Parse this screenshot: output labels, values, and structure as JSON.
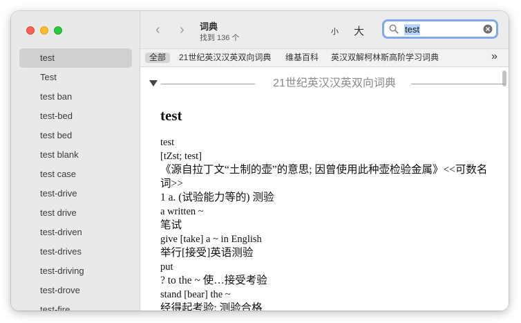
{
  "sidebar": {
    "items": [
      "test",
      "Test",
      "test ban",
      "test-bed",
      "test bed",
      "test blank",
      "test case",
      "test-drive",
      "test drive",
      "test-driven",
      "test-drives",
      "test-driving",
      "test-drove",
      "test-fire"
    ]
  },
  "toolbar": {
    "back": "‹",
    "forward": "›",
    "title": "词典",
    "subtitle": "找到 136 个",
    "font_small": "小",
    "font_large": "大",
    "search_value": "test"
  },
  "tabs": [
    "全部",
    "21世纪英汉汉英双向词典",
    "维基百科",
    "英汉双解柯林斯高阶学习词典"
  ],
  "more_tabs": "»",
  "content": {
    "dictionary_name": "21世纪英汉汉英双向词典",
    "headword": "test",
    "lines": [
      "test",
      "[tZst; test]",
      "《源自拉丁文“土制的壶”的意思; 因曾使用此种壶检验金属》<<可数名词>>",
      "1 a. (试验能力等的) 测验",
      "a written ~",
      "笔试",
      "give [take] a ~ in English",
      "举行[接受]英语测验",
      "put",
      "? to the ~ 使…接受考验",
      "stand [bear] the ~",
      "经得起考验; 测验合格"
    ]
  },
  "colors": {
    "sidebar_bg": "#e9e9e9",
    "selection": "#d0d0d0",
    "search_focus": "#7fa9e8",
    "text_highlight": "#b3d4fd"
  },
  "icons": {
    "search": "search-icon",
    "clear": "clear-icon",
    "disclosure": "disclosure-triangle-icon"
  }
}
